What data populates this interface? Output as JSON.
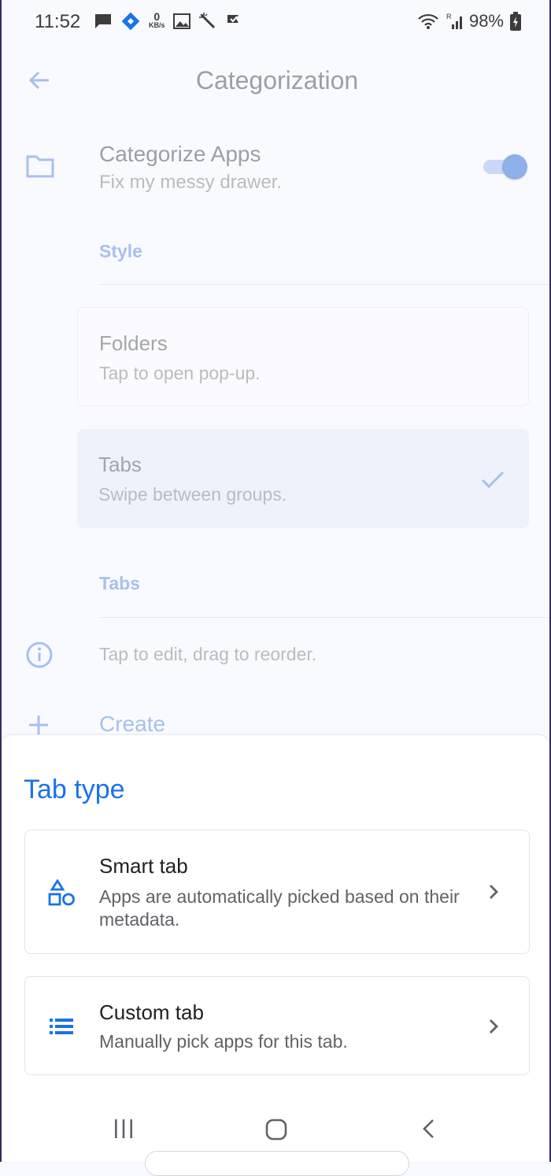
{
  "status_bar": {
    "time": "11:52",
    "net_speed_value": "0",
    "net_speed_unit": "KB/s",
    "battery": "98%"
  },
  "app_bar": {
    "title": "Categorization"
  },
  "categorize": {
    "title": "Categorize Apps",
    "subtitle": "Fix my messy drawer.",
    "toggle_on": true
  },
  "style_section": {
    "header": "Style",
    "options": [
      {
        "title": "Folders",
        "subtitle": "Tap to open pop-up.",
        "selected": false
      },
      {
        "title": "Tabs",
        "subtitle": "Swipe between groups.",
        "selected": true
      }
    ]
  },
  "tabs_section": {
    "header": "Tabs",
    "info": "Tap to edit, drag to reorder.",
    "create_label": "Create"
  },
  "sheet": {
    "title": "Tab type",
    "options": [
      {
        "title": "Smart tab",
        "subtitle": "Apps are automatically picked based on their metadata.",
        "icon": "shapes-icon"
      },
      {
        "title": "Custom tab",
        "subtitle": "Manually pick apps for this tab.",
        "icon": "list-icon"
      }
    ]
  },
  "colors": {
    "accent": "#1a73e8",
    "faded_accent": "#a6c0ef"
  }
}
